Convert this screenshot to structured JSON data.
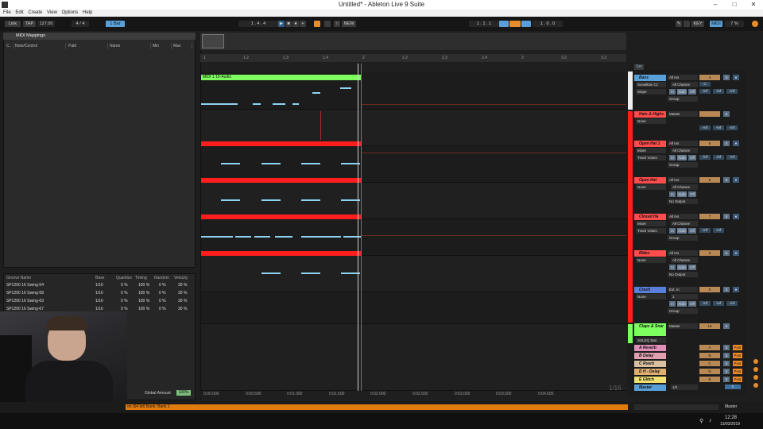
{
  "window": {
    "title": "Untitled* - Ableton Live 9 Suite"
  },
  "menu": [
    "File",
    "Edit",
    "Create",
    "View",
    "Options",
    "Help"
  ],
  "transport": {
    "link": "Link",
    "tap": "TAP",
    "tempo": "127.00",
    "time_sig": "4 / 4",
    "quantize": "1 Bar",
    "position": "1 . 4 . 4",
    "new": "NEW",
    "loop_start": "1 . 1 . 1",
    "loop_len": "1 . 0 . 0",
    "key": "KEY",
    "midi": "MIDI",
    "cpu": "7 %"
  },
  "midi_mappings": {
    "title": "MIDI Mappings",
    "columns": [
      "C..",
      "Note/Control",
      "Path",
      "Name",
      "Min",
      "Max"
    ]
  },
  "groove_pool": {
    "columns": [
      "Groove Name",
      "Base",
      "Quantize",
      "Timing",
      "Random",
      "Velocity"
    ],
    "rows": [
      {
        "name": "SP1200 16 Swing-54",
        "base": "1/16",
        "quantize": "0 %",
        "timing": "100 %",
        "random": "0 %",
        "velocity": "30 %"
      },
      {
        "name": "SP1200 16 Swing-58",
        "base": "1/16",
        "quantize": "0 %",
        "timing": "100 %",
        "random": "0 %",
        "velocity": "30 %"
      },
      {
        "name": "SP1200 16 Swing-63",
        "base": "1/16",
        "quantize": "0 %",
        "timing": "100 %",
        "random": "0 %",
        "velocity": "30 %"
      },
      {
        "name": "SP1200 16 Swing-67",
        "base": "1/16",
        "quantize": "0 %",
        "timing": "100 %",
        "random": "0 %",
        "velocity": "30 %"
      }
    ],
    "global_amount_label": "Global Amount",
    "global_amount": "100%"
  },
  "ruler": [
    "1",
    "1.2",
    "1.3",
    "1.4",
    "2",
    "2.2",
    "2.3",
    "2.4",
    "3",
    "3.2",
    "3.3"
  ],
  "timeline": [
    "0:00.000",
    "0:00.500",
    "0:01.000",
    "0:01.500",
    "0:02.000",
    "0:02.500",
    "0:03.000",
    "0:03.500",
    "0:04.000"
  ],
  "clip": {
    "name": "MIDI 1 16-Audio"
  },
  "grid_label": "1/16",
  "set_label": "Set",
  "tracks": [
    {
      "name": "Bass",
      "input": "All Ins",
      "channel": "All Channe",
      "device": "Sonalksis Cz",
      "param": "Slope",
      "monitor": [
        "In",
        "Auto",
        "Off"
      ],
      "route": "Group",
      "vol": "4",
      "inf": [
        "-inf",
        "-inf",
        "-inf"
      ]
    },
    {
      "name": "Hats & Highs",
      "input": "Master",
      "device": "None",
      "vol": "",
      "inf": [
        "-inf",
        "-inf",
        "-inf"
      ]
    },
    {
      "name": "Open Hat 1",
      "input": "All Ins",
      "channel": "All Channe",
      "device": "Mixer",
      "param": "Track Volum",
      "monitor": [
        "In",
        "Auto",
        "Off"
      ],
      "route": "Group",
      "vol": "5",
      "inf": [
        "-inf",
        "-inf",
        "-inf"
      ]
    },
    {
      "name": "Open Hat",
      "input": "All Ins",
      "channel": "All Channe",
      "device": "None",
      "monitor": [
        "In",
        "Auto",
        "Off"
      ],
      "route": "No Output",
      "vol": "6",
      "inf": []
    },
    {
      "name": "Closed Ha",
      "input": "All Ins",
      "channel": "All Channe",
      "device": "Mixer",
      "param": "Track Volum",
      "monitor": [
        "In",
        "Auto",
        "Off"
      ],
      "route": "Group",
      "vol": "7",
      "inf": [
        "-inf",
        "-inf"
      ]
    },
    {
      "name": "Rides",
      "input": "All Ins",
      "channel": "All Channe",
      "device": "None",
      "monitor": [
        "In",
        "Auto",
        "Off"
      ],
      "route": "No Output",
      "vol": "8",
      "inf": []
    },
    {
      "name": "Crash",
      "input": "Ext. In",
      "channel": "1",
      "device": "None",
      "monitor": [
        "In",
        "Auto",
        "Off"
      ],
      "route": "Group",
      "vol": "9",
      "inf": [
        "-inf",
        "-inf",
        "-inf"
      ]
    },
    {
      "name": "Claps & Snar",
      "input": "Master",
      "device": "SSLEQ Ster",
      "vol": "10",
      "inf": []
    }
  ],
  "returns": [
    {
      "name": "A Reverb",
      "letter": "A",
      "post": "Post"
    },
    {
      "name": "B Delay",
      "letter": "B",
      "post": "Post"
    },
    {
      "name": "C Rverb",
      "letter": "C",
      "post": "Post"
    },
    {
      "name": "D H - Delay",
      "letter": "D",
      "post": "Post"
    },
    {
      "name": "E Glitch",
      "letter": "E",
      "post": "Post"
    }
  ],
  "master": {
    "name": "Master",
    "cue": "1/2",
    "value": "0"
  },
  "status": {
    "text": "on (64 bit) Bank: Bank 1",
    "master": "Master"
  },
  "taskbar": {
    "time": "12:28",
    "date": "13/03/2019"
  },
  "colors": {
    "accent": "#e88b2a",
    "clip_red": "#ff1e1e",
    "clip_green": "#7dff5f",
    "note_blue": "#8fd3f4",
    "bass": "#5aa0d8"
  }
}
